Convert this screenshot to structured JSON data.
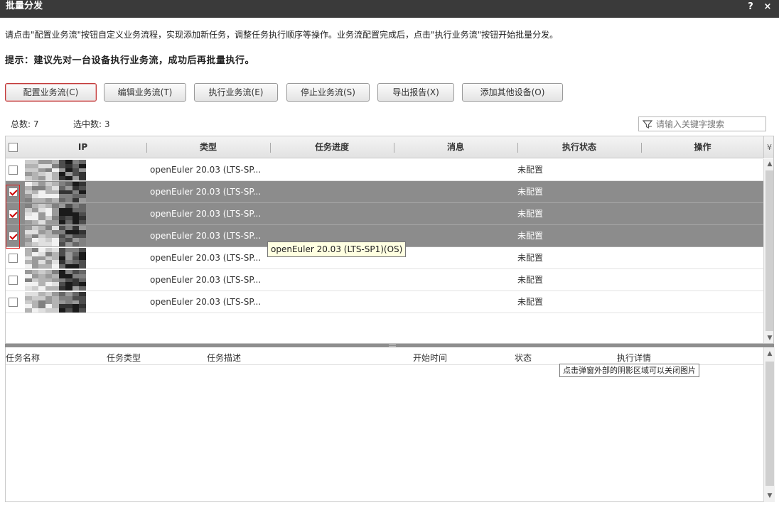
{
  "window": {
    "title": "批量分发",
    "help_label": "?",
    "close_label": "×"
  },
  "intro_text": "请点击\"配置业务流\"按钮自定义业务流程，实现添加新任务，调整任务执行顺序等操作。业务流配置完成后，点击\"执行业务流\"按钮开始批量分发。",
  "hint_text": "提示：建议先对一台设备执行业务流，成功后再批量执行。",
  "toolbar": {
    "configure": "配置业务流(C)",
    "edit": "编辑业务流(T)",
    "execute": "执行业务流(E)",
    "stop": "停止业务流(S)",
    "export": "导出报告(X)",
    "add_device": "添加其他设备(O)"
  },
  "stats": {
    "total": "总数: 7",
    "selected": "选中数: 3"
  },
  "search": {
    "placeholder": "请输入关键字搜索"
  },
  "grid": {
    "columns": [
      "IP",
      "类型",
      "任务进度",
      "消息",
      "执行状态",
      "操作"
    ],
    "rows": [
      {
        "type": "openEuler 20.03 (LTS-SP...",
        "status": "未配置",
        "checked": false
      },
      {
        "type": "openEuler 20.03 (LTS-SP...",
        "status": "未配置",
        "checked": true
      },
      {
        "type": "openEuler 20.03 (LTS-SP...",
        "status": "未配置",
        "checked": true
      },
      {
        "type": "openEuler 20.03 (LTS-SP...",
        "status": "未配置",
        "checked": true
      },
      {
        "type": "openEuler 20.03 (LTS-SP...",
        "status": "未配置",
        "checked": false
      },
      {
        "type": "openEuler 20.03 (LTS-SP...",
        "status": "未配置",
        "checked": false
      },
      {
        "type": "openEuler 20.03 (LTS-SP...",
        "status": "未配置",
        "checked": false
      }
    ]
  },
  "tooltip": "openEuler 20.03 (LTS-SP1)(OS)",
  "tasks": {
    "columns": [
      "任务名称",
      "任务类型",
      "任务描述",
      "开始时间",
      "状态",
      "执行详情"
    ]
  },
  "overlay_tip": "点击弹窗外部的阴影区域可以关闭图片",
  "colors": {
    "titlebar": "#3a3a3a",
    "selected_row": "#8c8c8c",
    "check_mark": "#cc0000",
    "highlight_box": "#e02020"
  }
}
